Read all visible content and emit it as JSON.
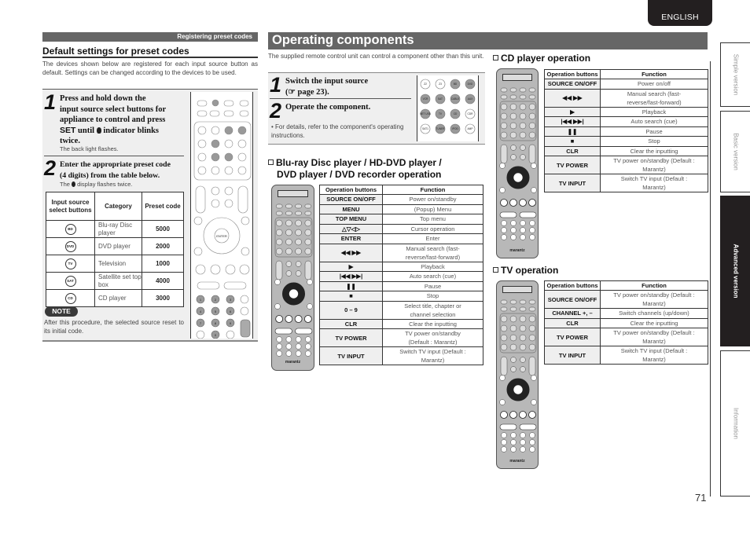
{
  "language_tab": "ENGLISH",
  "page_number": "71",
  "left_section": {
    "section_bar": "Registering preset codes",
    "heading": "Default settings for preset codes",
    "intro": "The devices shown below are registered for each input source button as default. Settings can be changed according to the devices to be used.",
    "steps": [
      {
        "number": "1",
        "lines": [
          "Press and hold down the",
          "input source select buttons for",
          "appliance to control and press",
          "SET until ",
          " indicator blinks",
          "twice."
        ],
        "note": "The back light flashes."
      },
      {
        "number": "2",
        "lines": [
          "Enter the appropriate preset code",
          "(4 digits) from the table below."
        ],
        "note_prefix": "The ",
        "note_suffix": " display flashes twice."
      }
    ],
    "table": {
      "headers": [
        "Input source select buttons",
        "Category",
        "Preset code"
      ],
      "rows": [
        {
          "button": "BD",
          "category": "Blu-ray Disc player",
          "code": "5000"
        },
        {
          "button": "DVD",
          "category": "DVD player",
          "code": "2000"
        },
        {
          "button": "TV",
          "category": "Television",
          "code": "1000"
        },
        {
          "button": "SAT",
          "category": "Satellite set top box",
          "code": "4000"
        },
        {
          "button": "CD",
          "category": "CD player",
          "code": "3000"
        }
      ]
    },
    "note_label": "NOTE",
    "note_text": "After this procedure, the selected source reset to its initial code."
  },
  "operating": {
    "title": "Operating components",
    "intro": "The supplied remote control unit can control a component other than this unit.",
    "steps": [
      {
        "number": "1",
        "text_line1": "Switch the input source",
        "text_line2": "(☞ page 23)."
      },
      {
        "number": "2",
        "text_line1": "Operate the component."
      }
    ],
    "bullet": "• For details, refer to the component's operating instructions.",
    "remote_buttons": [
      "Z2",
      "Z3",
      "BD",
      "DVD",
      "VCR",
      "SAT",
      "CABLE",
      "AUX",
      "NET USB",
      "TV",
      "CD",
      "CDR",
      "SAT1",
      "TUNER",
      "iPOD",
      "AMP"
    ],
    "bluray": {
      "heading_line1": "Blu-ray Disc player / HD-DVD player /",
      "heading_line2": "DVD player / DVD recorder operation",
      "headers": [
        "Operation buttons",
        "Function"
      ],
      "rows": [
        {
          "button": "SOURCE ON/OFF",
          "function": "Power on/standby"
        },
        {
          "button": "MENU",
          "function": "(Popup) Menu"
        },
        {
          "button": "TOP MENU",
          "function": "Top menu"
        },
        {
          "button": "△▽◁▷",
          "function": "Cursor operation"
        },
        {
          "button": "ENTER",
          "function": "Enter"
        },
        {
          "button": "◀◀  ▶▶",
          "function": "Manual search (fast-reverse/fast-forward)"
        },
        {
          "button": "▶",
          "function": "Playback"
        },
        {
          "button": "|◀◀  ▶▶|",
          "function": "Auto search (cue)"
        },
        {
          "button": "❚❚",
          "function": "Pause"
        },
        {
          "button": "■",
          "function": "Stop"
        },
        {
          "button": "0 – 9",
          "function": "Select title, chapter or channel selection"
        },
        {
          "button": "CLR",
          "function": "Clear the inputting"
        },
        {
          "button": "TV POWER",
          "function": "TV power on/standby (Default : Marantz)"
        },
        {
          "button": "TV INPUT",
          "function": "Switch TV input (Default : Marantz)"
        }
      ]
    },
    "cd": {
      "heading": "CD player operation",
      "headers": [
        "Operation buttons",
        "Function"
      ],
      "rows": [
        {
          "button": "SOURCE ON/OFF",
          "function": "Power on/off"
        },
        {
          "button": "◀◀  ▶▶",
          "function": "Manual search (fast-reverse/fast-forward)"
        },
        {
          "button": "▶",
          "function": "Playback"
        },
        {
          "button": "|◀◀  ▶▶|",
          "function": "Auto search (cue)"
        },
        {
          "button": "❚❚",
          "function": "Pause"
        },
        {
          "button": "■",
          "function": "Stop"
        },
        {
          "button": "CLR",
          "function": "Clear the inputting"
        },
        {
          "button": "TV POWER",
          "function": "TV power on/standby (Default : Marantz)"
        },
        {
          "button": "TV INPUT",
          "function": "Switch TV input (Default : Marantz)"
        }
      ]
    },
    "tv": {
      "heading": "TV operation",
      "headers": [
        "Operation buttons",
        "Function"
      ],
      "rows": [
        {
          "button": "SOURCE ON/OFF",
          "function": "TV power on/standby (Default : Marantz)"
        },
        {
          "button": "CHANNEL +, –",
          "function": "Switch channels (up/down)"
        },
        {
          "button": "CLR",
          "function": "Clear the inputting"
        },
        {
          "button": "TV POWER",
          "function": "TV power on/standby (Default : Marantz)"
        },
        {
          "button": "TV INPUT",
          "function": "Switch TV input (Default : Marantz)"
        }
      ]
    }
  },
  "remote": {
    "set_label": "SET",
    "brand": "marantz",
    "enter_label": "ENTER",
    "number_keys": [
      "1",
      "2",
      "3",
      "4",
      "5",
      "6",
      "7",
      "8",
      "9",
      "0"
    ]
  },
  "side_tabs": [
    {
      "label": "Simple version",
      "active": false
    },
    {
      "label": "Basic version",
      "active": false
    },
    {
      "label": "Advanced version",
      "active": true
    },
    {
      "label": "Information",
      "active": false
    }
  ]
}
